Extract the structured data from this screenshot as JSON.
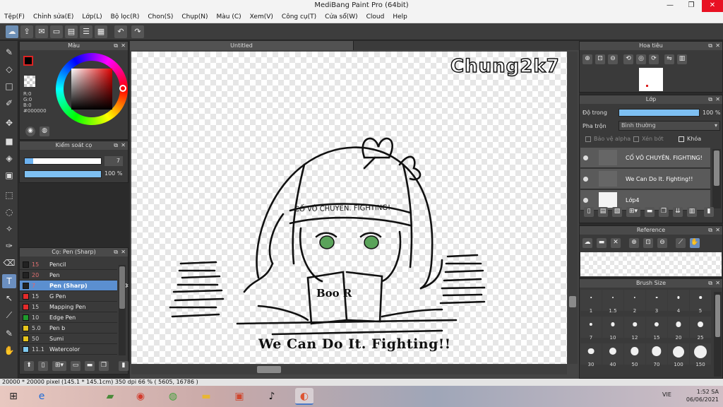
{
  "window": {
    "title": "MediBang Paint Pro (64bit)"
  },
  "menu": [
    "Tệp(F)",
    "Chỉnh sửa(E)",
    "Lớp(L)",
    "Bộ lọc(R)",
    "Chon(S)",
    "Chụp(N)",
    "Màu (C)",
    "Xem(V)",
    "Công cụ(T)",
    "Cửa sổ(W)",
    "Cloud",
    "Help"
  ],
  "color_panel": {
    "title": "Màu",
    "rgb": [
      "R:0",
      "G:0",
      "B:0"
    ],
    "hex": "#000000",
    "main_color": "#000000"
  },
  "size_panel": {
    "title": "Kiểm soát cọ",
    "size_value": "7",
    "opacity_label": "100 %",
    "opacity": 1.0
  },
  "brush_panel": {
    "title": "Cọ: Pen (Sharp)",
    "brushes": [
      {
        "size": "15",
        "name": "Pencil",
        "color": "#222222"
      },
      {
        "size": "20",
        "name": "Pen",
        "color": "#222222"
      },
      {
        "size": "7",
        "name": "Pen (Sharp)",
        "color": "#222222"
      },
      {
        "size": "15",
        "name": "G Pen",
        "color": "#e32b2b"
      },
      {
        "size": "15",
        "name": "Mapping Pen",
        "color": "#e32b2b"
      },
      {
        "size": "10",
        "name": "Edge Pen",
        "color": "#1f9a2c"
      },
      {
        "size": "5.0",
        "name": "Pen b",
        "color": "#e6c41d"
      },
      {
        "size": "50",
        "name": "Sumi",
        "color": "#e6c41d"
      },
      {
        "size": "11.1",
        "name": "Watercolor",
        "color": "#7fc9ee"
      }
    ]
  },
  "canvas": {
    "tab": "Untitled",
    "watermark": "Chung2k7",
    "headband_text": "CỐ VÔ CHUYÊN. FIGHTING!",
    "book_text": "Boo  R",
    "caption": "We Can Do It. Fighting!!"
  },
  "navigator_panel": {
    "title": "Hoa tiêu"
  },
  "layer_panel": {
    "title": "Lớp",
    "opacity_label": "Độ trong",
    "opacity_value": "100 %",
    "blend_label": "Pha trộn",
    "blend_value": "Bình thường",
    "alpha_label": "Bảo vệ alpha",
    "clip_label": "Xén bớt",
    "lock_label": "Khóa",
    "layers": [
      {
        "name": "CỐ VÔ CHUYÊN. FIGHTING!"
      },
      {
        "name": "We Can Do It. Fighting!!"
      },
      {
        "name": "Lớp4"
      }
    ]
  },
  "reference_panel": {
    "title": "Reference"
  },
  "brushsize_panel": {
    "title": "Brush Size",
    "sizes": [
      "1",
      "1.5",
      "2",
      "3",
      "4",
      "5",
      "7",
      "10",
      "12",
      "15",
      "20",
      "25",
      "30",
      "40",
      "50",
      "70",
      "100",
      "150"
    ]
  },
  "status": {
    "text": "20000 * 20000 pixel  (145.1 * 145.1cm)  350 dpi  66 %  ( 5605, 16786 )"
  },
  "taskbar": {
    "lang": "VIE",
    "time": "1:52 SA",
    "date": "06/06/2021"
  }
}
